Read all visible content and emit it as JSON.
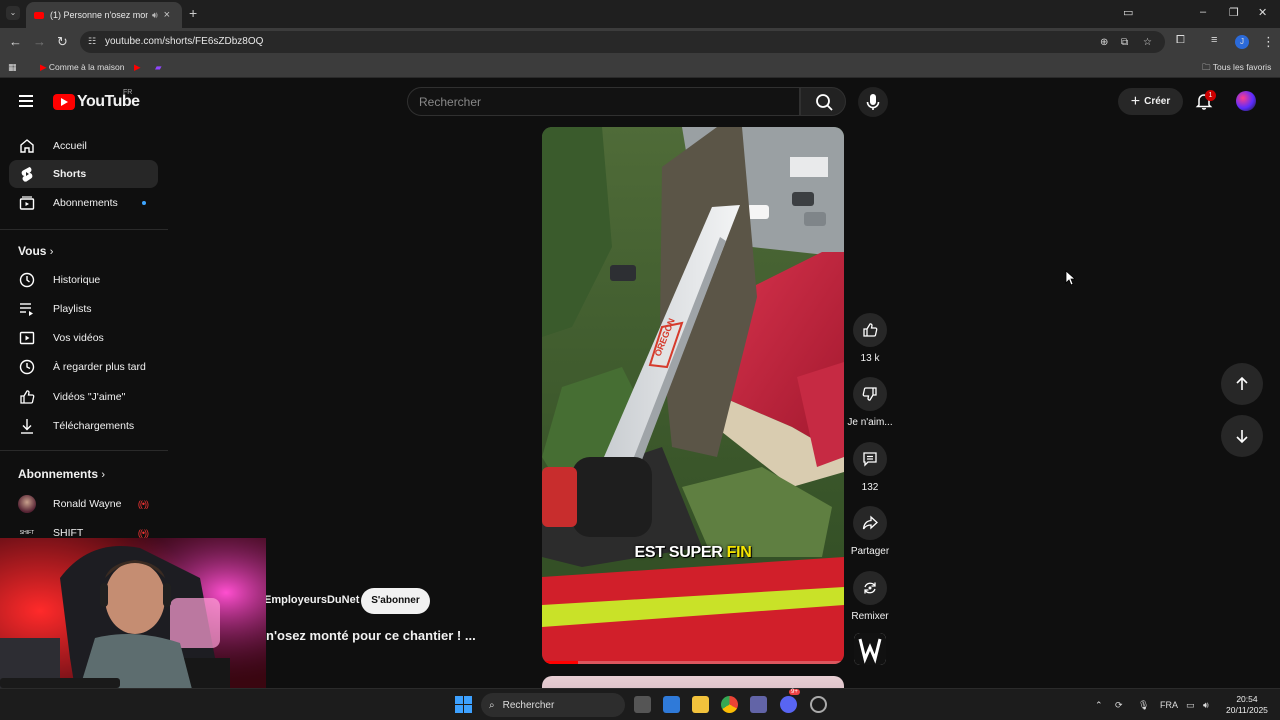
{
  "browser": {
    "tab_title": "(1) Personne n'osez monté",
    "url": "youtube.com/shorts/FE6sZDbz8OQ",
    "bookmarks": [
      {
        "label": "Comme à la maison"
      }
    ],
    "all_bookmarks_label": "Tous les favoris",
    "profile_initial": "J"
  },
  "header": {
    "logo_text": "YouTube",
    "country_code": "FR",
    "search_placeholder": "Rechercher",
    "create_label": "Créer",
    "notification_count": "1"
  },
  "sidebar": {
    "main": [
      {
        "label": "Accueil",
        "icon": "home-icon"
      },
      {
        "label": "Shorts",
        "icon": "shorts-icon",
        "active": true
      },
      {
        "label": "Abonnements",
        "icon": "subscriptions-icon"
      }
    ],
    "you_heading": "Vous",
    "you_items": [
      {
        "label": "Historique",
        "icon": "history-icon"
      },
      {
        "label": "Playlists",
        "icon": "playlist-icon"
      },
      {
        "label": "Vos vidéos",
        "icon": "your-videos-icon"
      },
      {
        "label": "À regarder plus tard",
        "icon": "watch-later-icon"
      },
      {
        "label": "Vidéos \"J'aime\"",
        "icon": "like-icon"
      },
      {
        "label": "Téléchargements",
        "icon": "download-icon"
      }
    ],
    "subs_heading": "Abonnements",
    "subs_items": [
      {
        "label": "Ronald Wayne"
      },
      {
        "label": "SHIFT"
      }
    ]
  },
  "short": {
    "caption_part1": "EST SUPER",
    "caption_highlight": "FIN",
    "progress": 0.12,
    "channel_name": "EmployeursDuNet",
    "subscribe_label": "S'abonner",
    "title": "n'osez monté pour ce chantier ! ..."
  },
  "actions": {
    "likes": "13 k",
    "dislike_label": "Je n'aim...",
    "comments": "132",
    "share_label": "Partager",
    "remix_label": "Remixer"
  },
  "taskbar": {
    "search_label": "Rechercher",
    "language": "FRA",
    "time": "20:54",
    "date": "20/11/2025",
    "discord_badge": "9+"
  },
  "colors": {
    "accent": "#ff0000",
    "caption_highlight": "#f4e500",
    "background": "#0f0f0f"
  }
}
